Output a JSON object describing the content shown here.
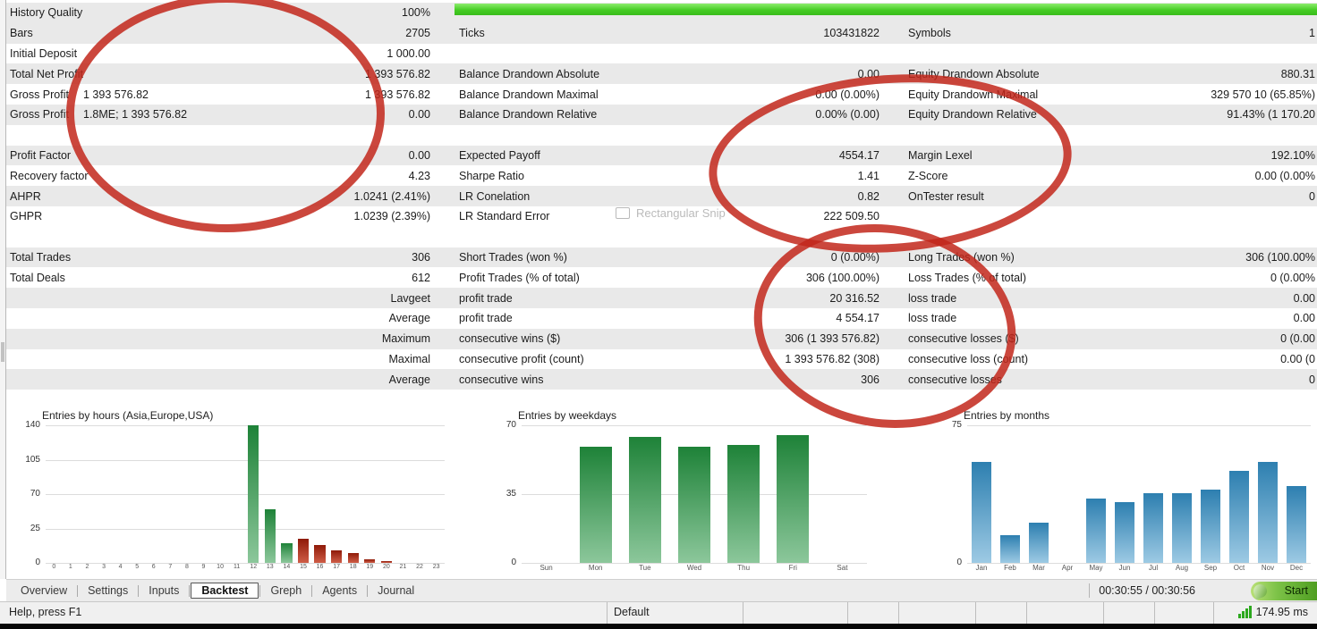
{
  "stats": {
    "rows": [
      {
        "l": "History Quality",
        "note": "",
        "lv": "100%",
        "m": "",
        "mv": "",
        "r": "",
        "rv": "",
        "shade": true
      },
      {
        "l": "Bars",
        "note": "",
        "lv": "2705",
        "m": "Ticks",
        "mv": "103431822",
        "r": "Symbols",
        "rv": "1",
        "shade": true
      },
      {
        "l": "Initial Deposit",
        "note": "",
        "lv": "1 000.00",
        "m": "",
        "mv": "",
        "r": "",
        "rv": "",
        "shade": false
      },
      {
        "l": "Total Net Profit",
        "note": "",
        "lv": "1 393 576.82",
        "m": "Balance Drandown Absolute",
        "mv": "0.00",
        "r": "Equity Drandown Absolute",
        "rv": "880.31",
        "shade": true
      },
      {
        "l": "Gross Profit",
        "note": "1 393 576.82",
        "lv": "1 393 576.82",
        "m": "Balance Drandown Maximal",
        "mv": "0.00 (0.00%)",
        "r": "Equity Drandown Maximal",
        "rv": "329 570 10 (65.85%)",
        "shade": false
      },
      {
        "l": "Gross Profit",
        "note": "1.8ME; 1 393 576.82",
        "lv": "0.00",
        "m": "Balance Drandown Relative",
        "mv": "0.00% (0.00)",
        "r": "Equity Drandown Relative",
        "rv": "91.43% (1 170.20",
        "shade": true
      },
      {
        "l": "",
        "note": "",
        "lv": "",
        "m": "",
        "mv": "",
        "r": "",
        "rv": "",
        "shade": false
      },
      {
        "l": "Profit Factor",
        "note": "",
        "lv": "0.00",
        "m": "Expected Payoff",
        "mv": "4554.17",
        "r": "Margin Lexel",
        "rv": "192.10%",
        "shade": true
      },
      {
        "l": "Recovery factor",
        "note": "",
        "lv": "4.23",
        "m": "Sharpe Ratio",
        "mv": "1.41",
        "r": "Z-Score",
        "rv": "0.00 (0.00%",
        "shade": false
      },
      {
        "l": "AHPR",
        "note": "",
        "lv": "1.0241 (2.41%)",
        "m": "LR Conelation",
        "mv": "0.82",
        "r": "OnTester result",
        "rv": "0",
        "shade": true
      },
      {
        "l": "GHPR",
        "note": "",
        "lv": "1.0239 (2.39%)",
        "m": "LR Standard Error",
        "mv": "222 509.50",
        "r": "",
        "rv": "",
        "shade": false
      },
      {
        "l": "",
        "note": "",
        "lv": "",
        "m": "",
        "mv": "",
        "r": "",
        "rv": "",
        "shade": false
      },
      {
        "l": "Total Trades",
        "note": "",
        "lv": "306",
        "m": "Short Trades (won %)",
        "mv": "0 (0.00%)",
        "r": "Long Trades (won %)",
        "rv": "306 (100.00%",
        "shade": true
      },
      {
        "l": "Total Deals",
        "note": "",
        "lv": "612",
        "m": "Profit Trades (% of total)",
        "mv": "306 (100.00%)",
        "r": "Loss Trades (% of total)",
        "rv": "0 (0.00%",
        "shade": false
      },
      {
        "l": "",
        "note": "",
        "lv": "Lavgeet",
        "m": "profit trade",
        "mv": "20 316.52",
        "r": "loss trade",
        "rv": "0.00",
        "shade": true
      },
      {
        "l": "",
        "note": "",
        "lv": "Average",
        "m": "profit trade",
        "mv": "4 554.17",
        "r": "loss trade",
        "rv": "0.00",
        "shade": false
      },
      {
        "l": "",
        "note": "",
        "lv": "Maximum",
        "m": "consecutive wins ($)",
        "mv": "306 (1 393 576.82)",
        "r": "consecutive losses ($)",
        "rv": "0 (0.00",
        "shade": true
      },
      {
        "l": "",
        "note": "",
        "lv": "Maximal",
        "m": "consecutive profit (count)",
        "mv": "1 393 576.82 (308)",
        "r": "consecutive loss (count)",
        "rv": "0.00 (0",
        "shade": false
      },
      {
        "l": "",
        "note": "",
        "lv": "Average",
        "m": "consecutive wins",
        "mv": "306",
        "r": "consecutive losses",
        "rv": "0",
        "shade": true
      }
    ]
  },
  "watermark": {
    "label": "Rectangular Snip"
  },
  "chart_data": [
    {
      "type": "bar",
      "title": "Entries by hours (Asia,Europe,USA)",
      "categories": [
        "0",
        "1",
        "2",
        "3",
        "4",
        "5",
        "6",
        "7",
        "8",
        "9",
        "10",
        "11",
        "12",
        "13",
        "14",
        "15",
        "16",
        "17",
        "18",
        "19",
        "20",
        "21",
        "22",
        "23"
      ],
      "values": [
        0,
        0,
        0,
        0,
        0,
        0,
        0,
        0,
        0,
        0,
        0,
        0,
        140,
        55,
        20,
        25,
        18,
        13,
        10,
        4,
        2,
        0,
        0,
        0
      ],
      "bar_colors": [
        "green",
        "green",
        "green",
        "green",
        "green",
        "green",
        "green",
        "green",
        "green",
        "green",
        "green",
        "green",
        "green",
        "green",
        "green",
        "red",
        "red",
        "red",
        "red",
        "red",
        "red",
        "red",
        "red",
        "red"
      ],
      "ylim": [
        0,
        140
      ],
      "yticks": [
        "140",
        "105",
        "70",
        "25",
        "0"
      ],
      "xlabel": "",
      "ylabel": ""
    },
    {
      "type": "bar",
      "title": "Entries by weekdays",
      "categories": [
        "Sun",
        "Mon",
        "Tue",
        "Wed",
        "Thu",
        "Fri",
        "Sat"
      ],
      "values": [
        0,
        59,
        64,
        59,
        60,
        65,
        0
      ],
      "color": "green",
      "ylim": [
        0,
        70
      ],
      "yticks": [
        "70",
        "35",
        "0"
      ],
      "xlabel": "",
      "ylabel": ""
    },
    {
      "type": "bar",
      "title": "Entries by months",
      "categories": [
        "Jan",
        "Feb",
        "Mar",
        "Apr",
        "May",
        "Jun",
        "Jul",
        "Aug",
        "Sep",
        "Oct",
        "Nov",
        "Dec"
      ],
      "values": [
        55,
        15,
        22,
        0,
        35,
        33,
        38,
        38,
        40,
        50,
        55,
        42
      ],
      "color": "blue",
      "ylim": [
        0,
        75
      ],
      "yticks": [
        "75",
        "0"
      ],
      "xlabel": "",
      "ylabel": ""
    }
  ],
  "tabs": {
    "items": [
      {
        "label": "Overview",
        "active": false
      },
      {
        "label": "Settings",
        "active": false
      },
      {
        "label": "Inputs",
        "active": false
      },
      {
        "label": "Backtest",
        "active": true
      },
      {
        "label": "Greph",
        "active": false
      },
      {
        "label": "Agents",
        "active": false
      },
      {
        "label": "Journal",
        "active": false
      }
    ],
    "time": "00:30:55 / 00:30:56",
    "start_label": "Start"
  },
  "status": {
    "help": "Help, press F1",
    "profile": "Default",
    "ping": "174.95 ms"
  },
  "colors": {
    "progress_green": "#46cd24",
    "annotation_red": "#c2271b",
    "bar_green": "#1e8238",
    "bar_red": "#8f1a08",
    "bar_blue": "#2d7fb0",
    "row_shade": "#e9e9e9",
    "start_green": "#4f9e22"
  }
}
